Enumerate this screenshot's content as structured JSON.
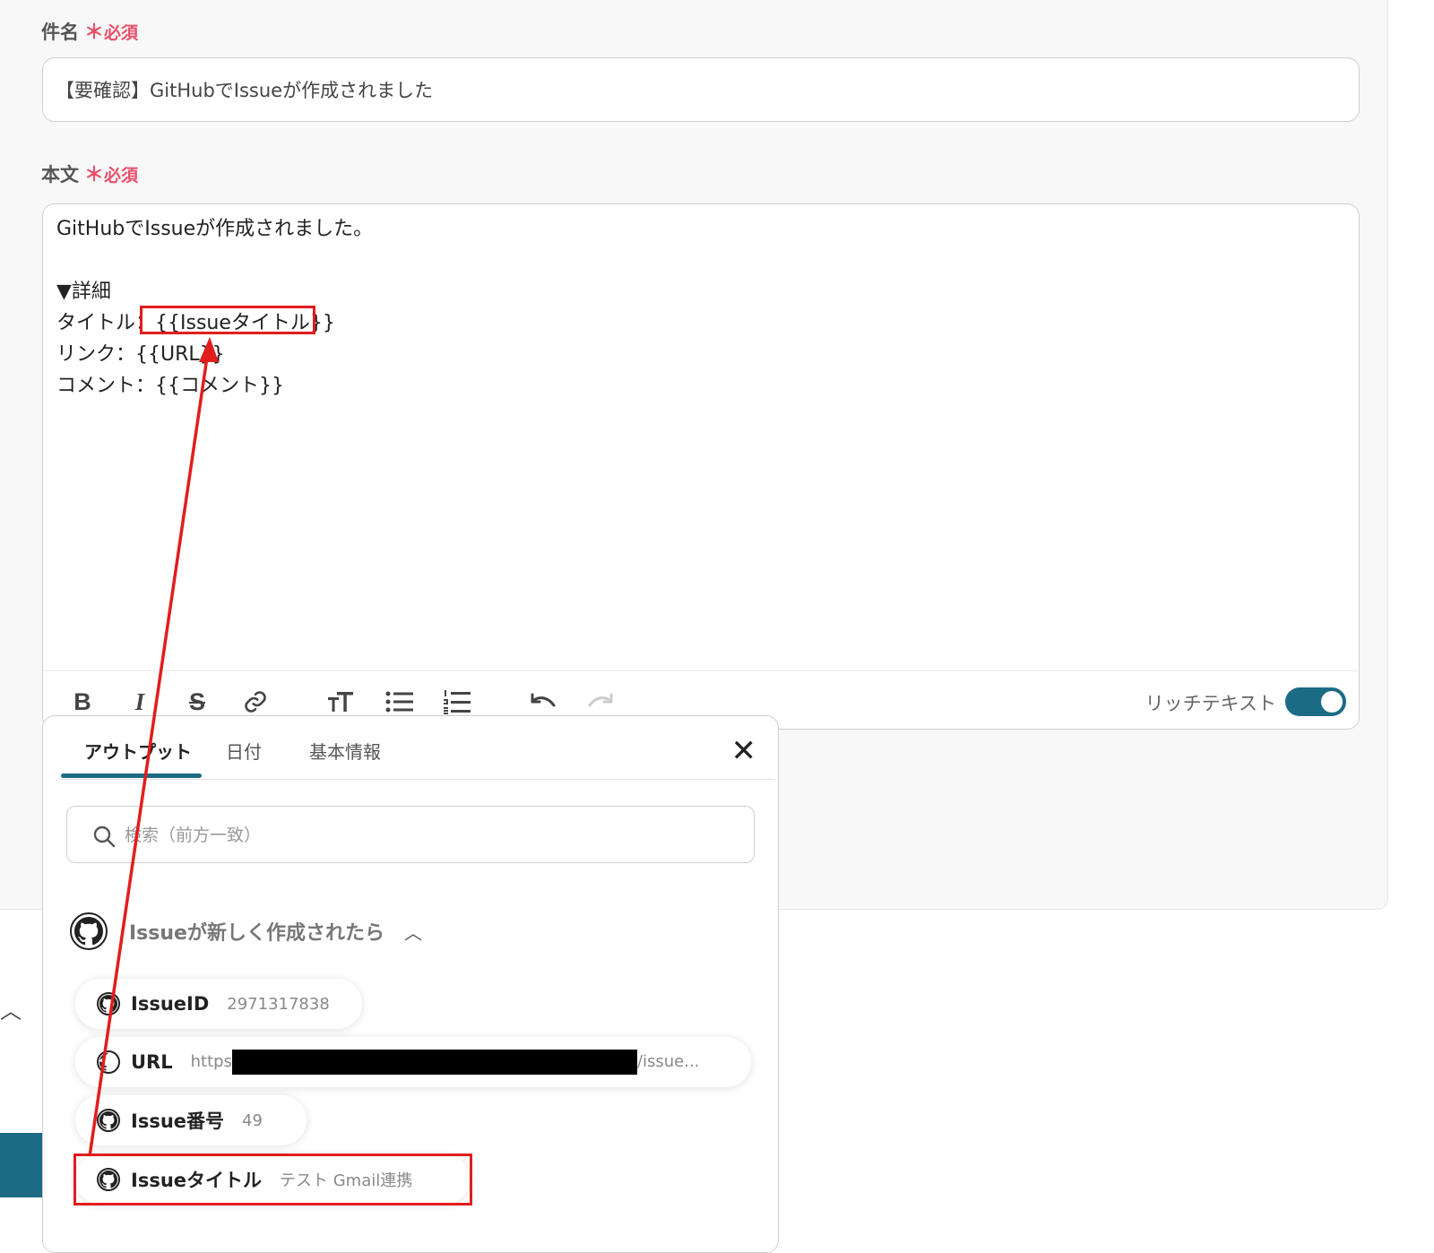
{
  "subject": {
    "label": "件名",
    "required_mark": "＊",
    "required_text": "必須",
    "value": "【要確認】GitHubでIssueが作成されました"
  },
  "body_field": {
    "label": "本文",
    "required_mark": "＊",
    "required_text": "必須",
    "lines": [
      "GitHubでIssueが作成されました。",
      "",
      "▼詳細",
      "タイトル：{{Issueタイトル}}",
      "リンク：{{URL}}",
      "コメント：{{コメント}}"
    ]
  },
  "toolbar": {
    "buttons": [
      "bold-icon",
      "italic-icon",
      "strikethrough-icon",
      "link-icon",
      "text-size-icon",
      "bulleted-list-icon",
      "numbered-list-icon",
      "undo-icon",
      "redo-icon"
    ],
    "rich_text_label": "リッチテキスト",
    "rich_text_enabled": true,
    "accent_color": "#1c6b85"
  },
  "popup": {
    "tabs": [
      "アウトプット",
      "日付",
      "基本情報"
    ],
    "active_tab": 0,
    "search_placeholder": "検索（前方一致）",
    "section_title": "Issueが新しく作成されたら",
    "items": [
      {
        "key": "IssueID",
        "value": "2971317838"
      },
      {
        "key": "URL",
        "value_prefix": "https",
        "value_suffix": "/issue..."
      },
      {
        "key": "Issue番号",
        "value": "49"
      },
      {
        "key": "Issueタイトル",
        "value": "テスト Gmail連携"
      }
    ]
  },
  "annotation_color": "#e21d1d"
}
